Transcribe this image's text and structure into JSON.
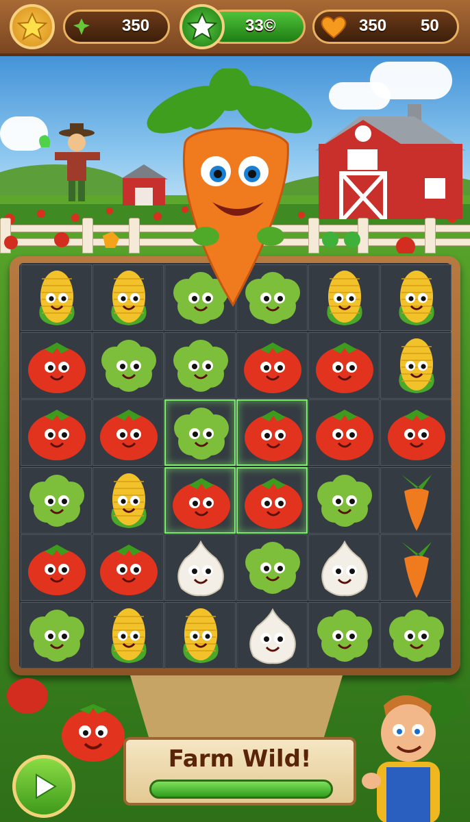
{
  "hud": {
    "star_icon": "star-icon",
    "clover_icon": "clover-icon",
    "score": "350",
    "level_icon": "green-star-icon",
    "moves": "33©",
    "heart_icon": "heart-icon",
    "lives": "350",
    "coins": "50"
  },
  "banner": {
    "title": "Farm Wild!"
  },
  "board": {
    "rows": [
      [
        "corn",
        "corn",
        "broccoli",
        "broccoli",
        "corn",
        "corn"
      ],
      [
        "tomato",
        "broccoli",
        "broccoli",
        "tomato",
        "tomato",
        "corn"
      ],
      [
        "tomato",
        "tomato",
        "broccoli",
        "tomato",
        "tomato",
        "tomato"
      ],
      [
        "broccoli",
        "corn",
        "tomato",
        "tomato",
        "broccoli",
        "carrot"
      ],
      [
        "tomato",
        "tomato",
        "garlic",
        "broccoli",
        "garlic",
        "carrot"
      ],
      [
        "broccoli",
        "corn",
        "corn",
        "garlic",
        "broccoli",
        "broccoli"
      ]
    ],
    "highlighted": [
      [
        2,
        2
      ],
      [
        2,
        3
      ],
      [
        3,
        2
      ],
      [
        3,
        3
      ]
    ]
  },
  "colors": {
    "tomato": "#e2331f",
    "broccoli": "#7dbf3a",
    "corn": "#f2c22b",
    "garlic": "#f3efe6",
    "carrot": "#f07a1e",
    "highlight": "#7cf06a"
  }
}
